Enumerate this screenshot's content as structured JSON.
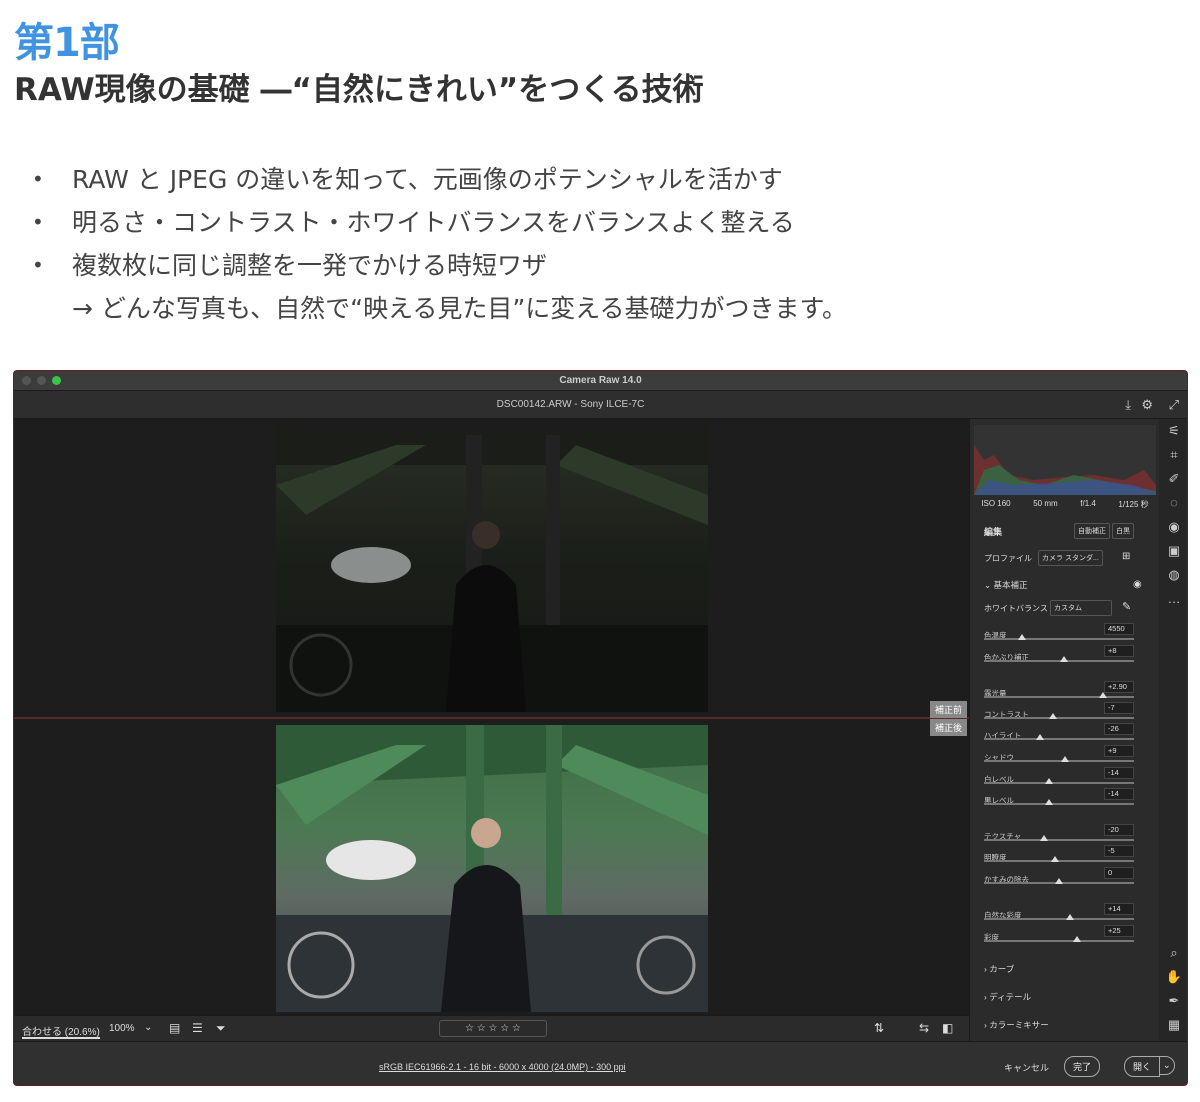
{
  "slide": {
    "part": "第1部",
    "title": "RAW現像の基礎 ―“自然にきれい”をつくる技術",
    "bullets": [
      "RAW と JPEG の違いを知って、元画像のポテンシャルを活かす",
      "明るさ・コントラスト・ホワイトバランスをバランスよく整える",
      "複数枚に同じ調整を一発でかける時短ワザ"
    ],
    "note": "→ どんな写真も、自然で“映える見た目”に変える基礎力がつきます。"
  },
  "app": {
    "window_title": "Camera Raw 14.0",
    "file_info": "DSC00142.ARW  -  Sony ILCE-7C",
    "before_tag": "補正前",
    "after_tag": "補正後",
    "zoom_fit": "合わせる (20.6%)",
    "zoom_level": "100%",
    "rating": "☆ ☆ ☆ ☆ ☆",
    "status_info": "sRGB IEC61966-2.1 - 16 bit - 6000 x 4000 (24.0MP) - 300 ppi",
    "cancel_label": "キャンセル",
    "done_label": "完了",
    "open_label": "開く"
  },
  "panel": {
    "exif": [
      "ISO 160",
      "50 mm",
      "f/1.4",
      "1/125 秒"
    ],
    "edit_label": "編集",
    "auto_label": "自動補正",
    "bw_label": "白黒",
    "profile_label": "プロファイル",
    "profile_value": "カメラ スタンダ...",
    "basic_label": "基本補正",
    "wb_label": "ホワイトバランス",
    "wb_value": "カスタム",
    "sliders": [
      {
        "label": "色温度",
        "value": "4550",
        "pos": 0.25
      },
      {
        "label": "色かぶり補正",
        "value": "+8",
        "pos": 0.53
      },
      {
        "label": "露光量",
        "value": "+2.90",
        "pos": 0.79
      },
      {
        "label": "コントラスト",
        "value": "-7",
        "pos": 0.46
      },
      {
        "label": "ハイライト",
        "value": "-26",
        "pos": 0.37
      },
      {
        "label": "シャドウ",
        "value": "+9",
        "pos": 0.54
      },
      {
        "label": "白レベル",
        "value": "-14",
        "pos": 0.43
      },
      {
        "label": "黒レベル",
        "value": "-14",
        "pos": 0.43
      },
      {
        "label": "テクスチャ",
        "value": "-20",
        "pos": 0.4
      },
      {
        "label": "明瞭度",
        "value": "-5",
        "pos": 0.47
      },
      {
        "label": "かすみの除去",
        "value": "0",
        "pos": 0.5
      },
      {
        "label": "自然な彩度",
        "value": "+14",
        "pos": 0.57
      },
      {
        "label": "彩度",
        "value": "+25",
        "pos": 0.62
      }
    ],
    "curve_label": "カーブ",
    "detail_label": "ディテール",
    "mixer_label": "カラーミキサー"
  }
}
